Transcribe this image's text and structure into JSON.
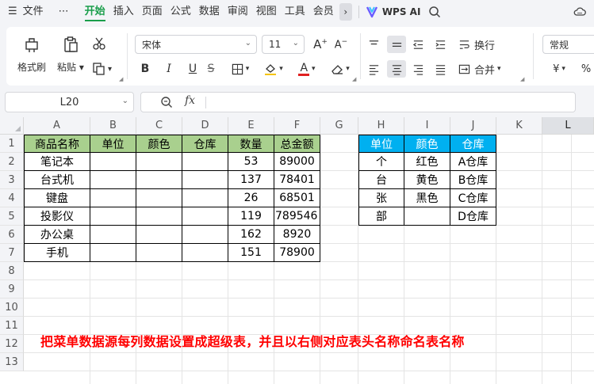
{
  "menubar": {
    "hamburger": "☰",
    "file": "文件",
    "more": "⋯",
    "tabs": [
      "开始",
      "插入",
      "页面",
      "公式",
      "数据",
      "审阅",
      "视图",
      "工具",
      "会员"
    ],
    "active_tab": "开始",
    "ai_label": "WPS AI"
  },
  "ribbon": {
    "format_painter": "格式刷",
    "paste": "粘贴",
    "font_name": "宋体",
    "font_size": "11",
    "bold": "B",
    "italic": "I",
    "underline": "U",
    "wrap": "换行",
    "merge": "合并",
    "number_format": "常规",
    "currency": "¥",
    "percent": "%",
    "font_color": "#e02020"
  },
  "formula_bar": {
    "cell_ref": "L20",
    "fx": "fx",
    "value": ""
  },
  "sheet": {
    "columns": [
      "A",
      "B",
      "C",
      "D",
      "E",
      "F",
      "G",
      "H",
      "I",
      "J",
      "K",
      "L"
    ],
    "selected_column": "L",
    "rows": [
      "1",
      "2",
      "3",
      "4",
      "5",
      "6",
      "7",
      "8",
      "9",
      "10",
      "11",
      "12",
      "13"
    ],
    "table1": {
      "headers": [
        "商品名称",
        "单位",
        "颜色",
        "仓库",
        "数量",
        "总金额"
      ],
      "rows": [
        [
          "笔记本",
          "",
          "",
          "",
          "53",
          "89000"
        ],
        [
          "台式机",
          "",
          "",
          "",
          "137",
          "78401"
        ],
        [
          "键盘",
          "",
          "",
          "",
          "26",
          "68501"
        ],
        [
          "投影仪",
          "",
          "",
          "",
          "119",
          "789546"
        ],
        [
          "办公桌",
          "",
          "",
          "",
          "162",
          "8920"
        ],
        [
          "手机",
          "",
          "",
          "",
          "151",
          "78900"
        ]
      ],
      "header_color": "#a9d08e"
    },
    "table2": {
      "headers": [
        "单位",
        "颜色",
        "仓库"
      ],
      "rows": [
        [
          "个",
          "红色",
          "A仓库"
        ],
        [
          "台",
          "黄色",
          "B仓库"
        ],
        [
          "张",
          "黑色",
          "C仓库"
        ],
        [
          "部",
          "",
          "D仓库"
        ]
      ],
      "header_color": "#00b0f0"
    },
    "note": "把菜单数据源每列数据设置成超级表，并且以右侧对应表头名称命名表名称",
    "note_color": "#ff0000"
  }
}
